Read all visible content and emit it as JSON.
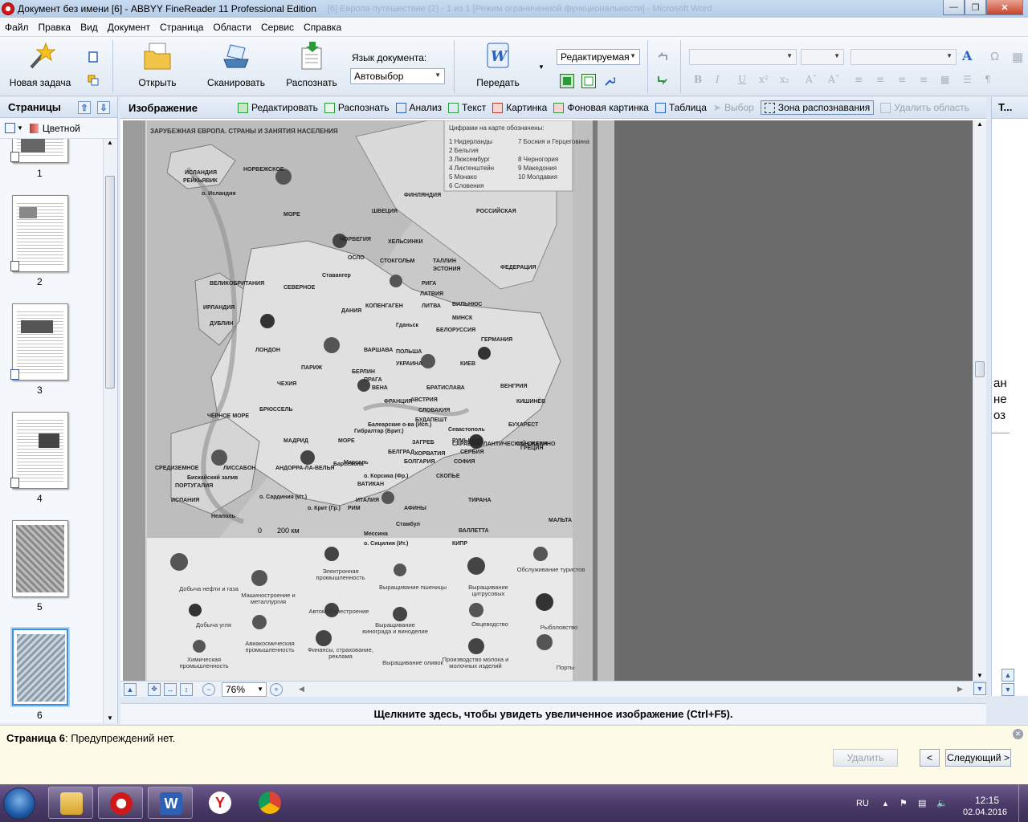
{
  "window": {
    "title": "Документ без имени [6] - ABBYY FineReader 11 Professional Edition",
    "ghost_title": "[6] Европа путешествие (2) - 1 из 1 [Режим ограниченной функциональности] - Microsoft Word"
  },
  "menu": [
    "Файл",
    "Правка",
    "Вид",
    "Документ",
    "Страница",
    "Области",
    "Сервис",
    "Справка"
  ],
  "toolbar": {
    "new_task": "Новая задача",
    "open": "Открыть",
    "scan": "Сканировать",
    "recognize": "Распознать",
    "language_label": "Язык документа:",
    "language_value": "Автовыбор",
    "send": "Передать",
    "mode_value": "Редактируемая"
  },
  "pages_panel": {
    "title": "Страницы",
    "color_mode": "Цветной",
    "pages": [
      "1",
      "2",
      "3",
      "4",
      "5",
      "6"
    ],
    "selected": "6"
  },
  "image_panel": {
    "title": "Изображение",
    "tools": [
      {
        "label": "Редактировать",
        "state": "normal",
        "color": "#2a9a3a"
      },
      {
        "label": "Распознать",
        "state": "normal",
        "color": "#2a9a3a"
      },
      {
        "label": "Анализ",
        "state": "normal",
        "color": "#2d61b8"
      },
      {
        "label": "Текст",
        "state": "normal",
        "color": "#2a9a3a"
      },
      {
        "label": "Картинка",
        "state": "normal",
        "color": "#c0392b"
      },
      {
        "label": "Фоновая картинка",
        "state": "normal",
        "color": "#2a9a3a"
      },
      {
        "label": "Таблица",
        "state": "normal",
        "color": "#2d61b8"
      },
      {
        "label": "Выбор",
        "state": "disabled",
        "color": "#9aa3ad"
      },
      {
        "label": "Зона распознавания",
        "state": "active",
        "color": "#333333"
      },
      {
        "label": "Удалить область",
        "state": "disabled",
        "color": "#9aa3ad"
      }
    ],
    "zoom": "76%"
  },
  "map": {
    "title": "ЗАРУБЕЖНАЯ ЕВРОПА. СТРАНЫ И ЗАНЯТИЯ НАСЕЛЕНИЯ",
    "legend_header": "Цифрами на карте обозначены:",
    "legend_items": [
      "1 Нидерланды",
      "2 Бельгия",
      "3 Люксембург",
      "4 Лихтенштейн",
      "5 Монако",
      "6 Словения",
      "7 Босния и Герцеговина",
      "8 Черногория",
      "9 Македония",
      "10 Молдавия"
    ],
    "labels": [
      "НОРВЕЖСКОЕ",
      "МОРЕ",
      "ИСЛАНДИЯ",
      "РЕЙКЬЯВИК",
      "о. Исландия",
      "НОРВЕГИЯ",
      "ШВЕЦИЯ",
      "ФИНЛЯНДИЯ",
      "РОССИЙСКАЯ",
      "ФЕДЕРАЦИЯ",
      "ХЕЛЬСИНКИ",
      "ОСЛО",
      "СТОКГОЛЬМ",
      "ТАЛЛИН",
      "ЭСТОНИЯ",
      "Ставангер",
      "ВЕЛИКОБРИТАНИЯ",
      "СЕВЕРНОЕ",
      "ИРЛАНДИЯ",
      "ДУБЛИН",
      "ЛОНДОН",
      "ДАНИЯ",
      "КОПЕНГАГЕН",
      "РИГА",
      "ЛАТВИЯ",
      "ЛИТВА",
      "ВИЛЬНЮС",
      "МИНСК",
      "БЕЛОРУССИЯ",
      "Гданьск",
      "ПОЛЬША",
      "ВАРШАВА",
      "БЕРЛИН",
      "ГЕРМАНИЯ",
      "КИЕВ",
      "УКРАИНА",
      "ПРАГА",
      "ЧЕХИЯ",
      "ПАРИЖ",
      "БРЮССЕЛЬ",
      "ФРАНЦИЯ",
      "ВЕНА",
      "АВСТРИЯ",
      "БРАТИСЛАВА",
      "СЛОВАКИЯ",
      "БУДАПЕШТ",
      "ВЕНГРИЯ",
      "КИШИНЁВ",
      "Севастополь",
      "РУМЫНИЯ",
      "БУХАРЕСТ",
      "ЧЁРНОЕ МОРЕ",
      "Бискайский залив",
      "ИСПАНИЯ",
      "ПОРТУГАЛИЯ",
      "ЛИССАБОН",
      "МАДРИД",
      "АНДОРРА-ЛА-ВЕЛЬЯ",
      "Марсель",
      "Барселона",
      "о. Корсика (Фр.)",
      "ВАТИКАН",
      "РИМ",
      "ИТАЛИЯ",
      "о. Сардиния (Ит.)",
      "Неаполь",
      "Балеарские о-ва (Исп.)",
      "Гибралтар (Брит.)",
      "ЗАГРЕБ",
      "ХОРВАТИЯ",
      "БЕЛГРАД",
      "СЕРБИЯ",
      "САРАЕВО",
      "СОФИЯ",
      "БОЛГАРИЯ",
      "СКОПЬЕ",
      "ТИРАНА",
      "ГРЕЦИЯ",
      "АФИНЫ",
      "Стамбул",
      "Мессина",
      "о. Сицилия (Ит.)",
      "ВАЛЛЕТТА",
      "МАЛЬТА",
      "о. Крит (Гр.)",
      "КИПР",
      "СРЕДИЗЕМНОЕ",
      "МОРЕ",
      "АТЛАНТИЧЕСКИЙ ОКЕАН",
      "САН-МАРИНО"
    ],
    "scale": "200 км",
    "scale_zero": "0",
    "icon_legend": [
      "Добыча нефти и газа",
      "Электронная промышленность",
      "Выращивание пшеницы",
      "Выращивание цитрусовых",
      "Обслуживание туристов",
      "Машиностроение и металлургия",
      "Автомобилестроение",
      "Добыча угля",
      "Выращивание винограда и виноделие",
      "Овцеводство",
      "Рыболовство",
      "Авиакосмическая промышленность",
      "Химическая промышленность",
      "Финансы, страхование, реклама",
      "Выращивание оливок",
      "Производство молока и молочных изделий",
      "Порты"
    ]
  },
  "zoom_hint": "Щелкните здесь, чтобы увидеть увеличенное изображение (Ctrl+F5).",
  "text_panel": {
    "title": "Т...",
    "fragments": [
      "ан",
      "не",
      "оз"
    ]
  },
  "warnings": {
    "page_label": "Страница 6",
    "message": ": Предупреждений нет.",
    "delete": "Удалить",
    "prev": "<",
    "next": "Следующий >"
  },
  "taskbar": {
    "lang": "RU",
    "time": "12:15",
    "date": "02.04.2016"
  }
}
